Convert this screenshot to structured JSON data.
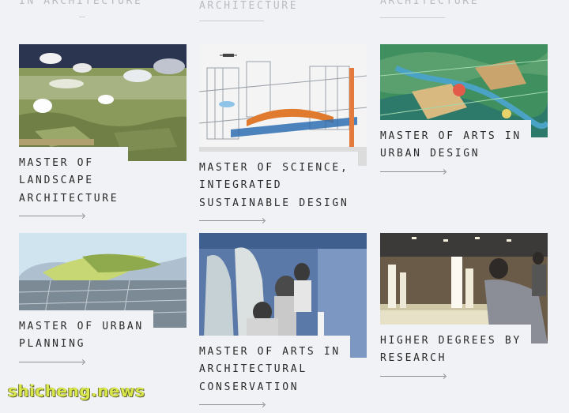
{
  "top_labels": [
    "IN ARCHITECTURE",
    "ARCHITECTURE",
    "ARCHITECTURE"
  ],
  "programs": [
    {
      "lines": [
        "MASTER OF",
        "LANDSCAPE",
        "ARCHITECTURE"
      ],
      "image": "landscape-aerial-image"
    },
    {
      "lines": [
        "MASTER OF SCIENCE,",
        "INTEGRATED",
        "SUSTAINABLE DESIGN"
      ],
      "image": "sustainable-design-rendering-image"
    },
    {
      "lines": [
        "MASTER OF ARTS IN",
        "URBAN DESIGN"
      ],
      "image": "urban-design-map-image"
    },
    {
      "lines": [
        "MASTER OF URBAN",
        "PLANNING"
      ],
      "image": "urban-planning-map-image"
    },
    {
      "lines": [
        "MASTER OF ARTS IN",
        "ARCHITECTURAL",
        "CONSERVATION"
      ],
      "image": "conservation-workers-image"
    },
    {
      "lines": [
        "HIGHER DEGREES BY",
        "RESEARCH"
      ],
      "image": "research-models-image"
    }
  ],
  "watermark": "shicheng.news",
  "colors": {
    "background": "#f1f2f5",
    "text": "#2a2a2a",
    "arrow": "#8c8f94"
  }
}
